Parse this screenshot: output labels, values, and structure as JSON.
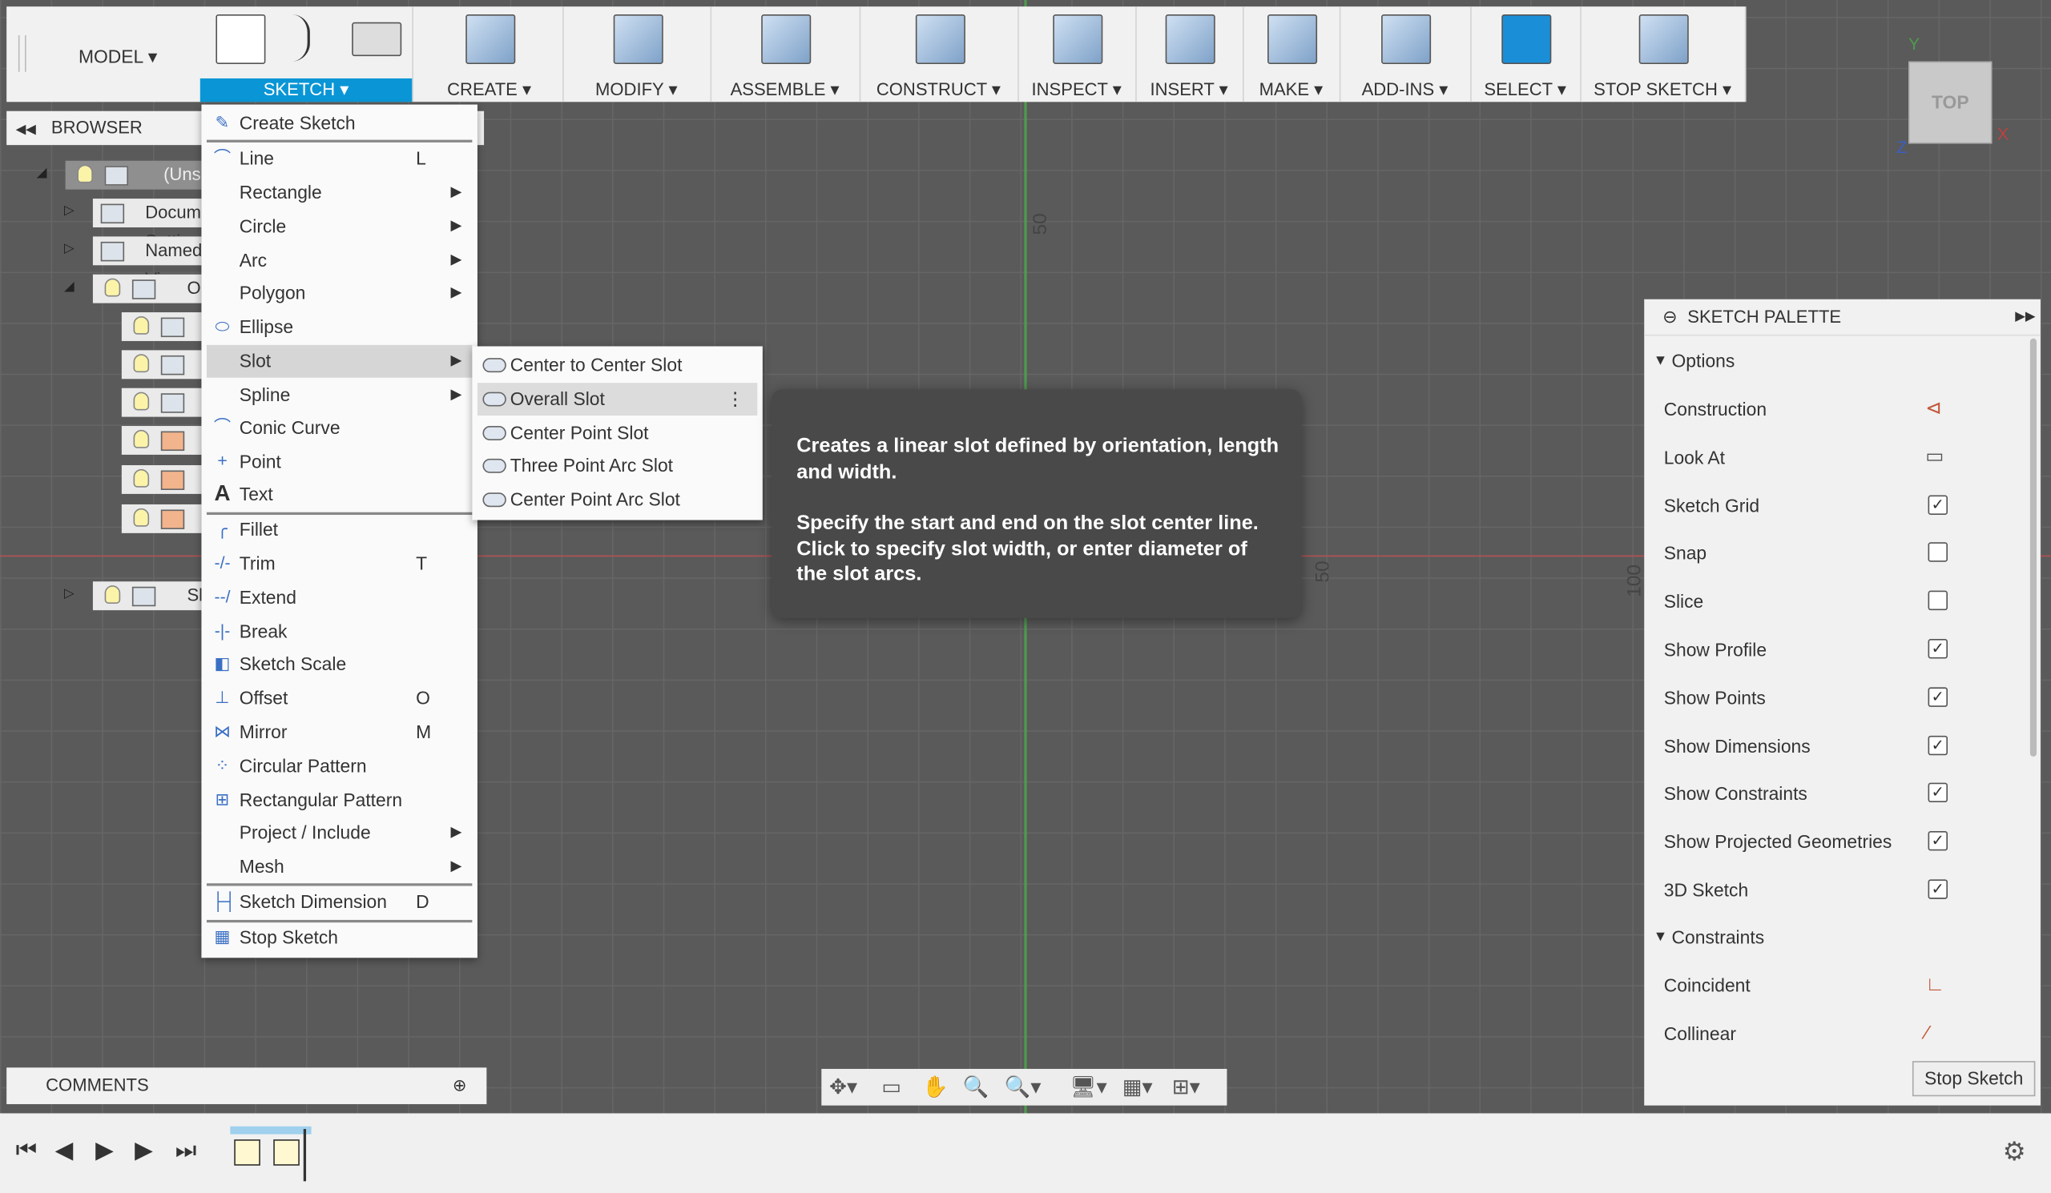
{
  "toolbar": {
    "workspace": "MODEL",
    "groups": [
      {
        "label": "SKETCH ▾",
        "active": true
      },
      {
        "label": "CREATE ▾"
      },
      {
        "label": "MODIFY ▾"
      },
      {
        "label": "ASSEMBLE ▾"
      },
      {
        "label": "CONSTRUCT ▾"
      },
      {
        "label": "INSPECT ▾"
      },
      {
        "label": "INSERT ▾"
      },
      {
        "label": "MAKE ▾"
      },
      {
        "label": "ADD-INS ▾"
      },
      {
        "label": "SELECT ▾"
      },
      {
        "label": "STOP SKETCH ▾"
      }
    ]
  },
  "browser": {
    "title": "BROWSER",
    "rows": [
      "(Unsaved)",
      "Document Settings",
      "Named Views",
      "Origin",
      "",
      "",
      "",
      "",
      "",
      "",
      "Sketches"
    ]
  },
  "canvas": {
    "dim_labels": [
      "50",
      "50",
      "100"
    ],
    "viewcube": "TOP",
    "axes": {
      "y": "Y",
      "x": "X",
      "z": "Z"
    },
    "colors": {
      "x_axis": "#b45252",
      "y_axis": "#4f9a4f",
      "accent": "#0a96d6"
    }
  },
  "sketch_menu": {
    "items": [
      {
        "label": "Create Sketch",
        "icon": "create-sketch-icon",
        "shortcut": "",
        "sub": false
      },
      {
        "label": "Line",
        "icon": "line-icon",
        "shortcut": "L",
        "sub": false
      },
      {
        "label": "Rectangle",
        "icon": "",
        "shortcut": "",
        "sub": true
      },
      {
        "label": "Circle",
        "icon": "",
        "shortcut": "",
        "sub": true
      },
      {
        "label": "Arc",
        "icon": "",
        "shortcut": "",
        "sub": true
      },
      {
        "label": "Polygon",
        "icon": "",
        "shortcut": "",
        "sub": true
      },
      {
        "label": "Ellipse",
        "icon": "ellipse-icon",
        "shortcut": "",
        "sub": false
      },
      {
        "label": "Slot",
        "icon": "",
        "shortcut": "",
        "sub": true,
        "highlighted": true
      },
      {
        "label": "Spline",
        "icon": "",
        "shortcut": "",
        "sub": true
      },
      {
        "label": "Conic Curve",
        "icon": "conic-curve-icon",
        "shortcut": "",
        "sub": false
      },
      {
        "label": "Point",
        "icon": "point-icon",
        "shortcut": "",
        "sub": false
      },
      {
        "label": "Text",
        "icon": "text-icon",
        "shortcut": "",
        "sub": false
      },
      {
        "label": "Fillet",
        "icon": "fillet-icon",
        "shortcut": "",
        "sub": false
      },
      {
        "label": "Trim",
        "icon": "trim-icon",
        "shortcut": "T",
        "sub": false
      },
      {
        "label": "Extend",
        "icon": "extend-icon",
        "shortcut": "",
        "sub": false
      },
      {
        "label": "Break",
        "icon": "break-icon",
        "shortcut": "",
        "sub": false
      },
      {
        "label": "Sketch Scale",
        "icon": "sketch-scale-icon",
        "shortcut": "",
        "sub": false
      },
      {
        "label": "Offset",
        "icon": "offset-icon",
        "shortcut": "O",
        "sub": false
      },
      {
        "label": "Mirror",
        "icon": "mirror-icon",
        "shortcut": "M",
        "sub": false
      },
      {
        "label": "Circular Pattern",
        "icon": "circular-pattern-icon",
        "shortcut": "",
        "sub": false
      },
      {
        "label": "Rectangular Pattern",
        "icon": "rectangular-pattern-icon",
        "shortcut": "",
        "sub": false
      },
      {
        "label": "Project / Include",
        "icon": "",
        "shortcut": "",
        "sub": true
      },
      {
        "label": "Mesh",
        "icon": "",
        "shortcut": "",
        "sub": true
      },
      {
        "label": "Sketch Dimension",
        "icon": "sketch-dimension-icon",
        "shortcut": "D",
        "sub": false
      },
      {
        "label": "Stop Sketch",
        "icon": "stop-sketch-icon",
        "shortcut": "",
        "sub": false
      }
    ]
  },
  "slot_submenu": {
    "items": [
      "Center to Center Slot",
      "Overall Slot",
      "Center Point Slot",
      "Three Point Arc Slot",
      "Center Point Arc Slot"
    ],
    "highlighted": "Overall Slot"
  },
  "tooltip": {
    "line1": "Creates a linear slot defined by orientation, length and width.",
    "line2": "Specify the start and end on the slot center line. Click to specify slot width, or enter diameter of the slot arcs."
  },
  "palette": {
    "title": "SKETCH PALETTE",
    "options_label": "Options",
    "options": [
      {
        "label": "Construction",
        "type": "icon"
      },
      {
        "label": "Look At",
        "type": "icon"
      },
      {
        "label": "Sketch Grid",
        "checked": true
      },
      {
        "label": "Snap",
        "checked": false
      },
      {
        "label": "Slice",
        "checked": false
      },
      {
        "label": "Show Profile",
        "checked": true
      },
      {
        "label": "Show Points",
        "checked": true
      },
      {
        "label": "Show Dimensions",
        "checked": true
      },
      {
        "label": "Show Constraints",
        "checked": true
      },
      {
        "label": "Show Projected Geometries",
        "checked": true
      },
      {
        "label": "3D Sketch",
        "checked": true
      }
    ],
    "constraints_label": "Constraints",
    "constraints": [
      "Coincident",
      "Collinear"
    ],
    "stop_button": "Stop Sketch"
  },
  "comments": {
    "title": "COMMENTS"
  }
}
